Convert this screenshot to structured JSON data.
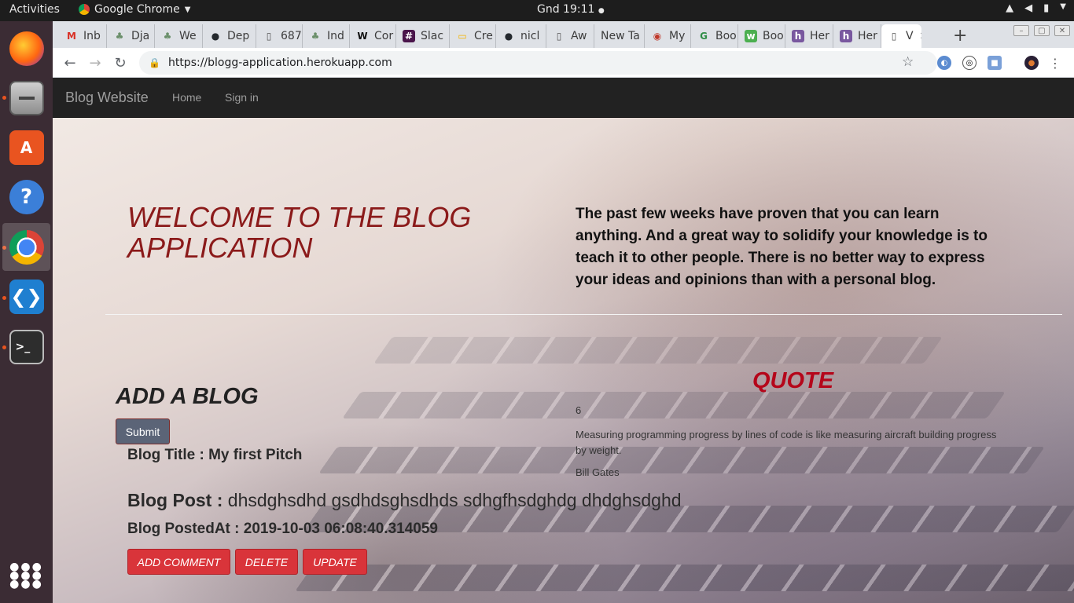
{
  "topbar": {
    "activities": "Activities",
    "app_name": "Google Chrome",
    "clock": "Gnd 19:11"
  },
  "dock": {
    "items": [
      "firefox-icon",
      "files-icon",
      "software-center-icon",
      "help-icon",
      "chrome-icon",
      "vscode-icon",
      "terminal-icon",
      "app-grid-icon"
    ]
  },
  "browser": {
    "tabs": [
      {
        "label": "Inb",
        "icon": "gmail-icon"
      },
      {
        "label": "Dja",
        "icon": "django-icon"
      },
      {
        "label": "We",
        "icon": "django-icon"
      },
      {
        "label": "Dep",
        "icon": "github-icon"
      },
      {
        "label": "687",
        "icon": "page-icon"
      },
      {
        "label": "Ind",
        "icon": "django-icon"
      },
      {
        "label": "Cor",
        "icon": "wikipedia-icon"
      },
      {
        "label": "Slac",
        "icon": "slack-icon"
      },
      {
        "label": "Cre",
        "icon": "slides-icon"
      },
      {
        "label": "nicl",
        "icon": "github-icon"
      },
      {
        "label": "Aw",
        "icon": "page-icon"
      },
      {
        "label": "New Ta",
        "icon": ""
      },
      {
        "label": "My",
        "icon": "mw-icon"
      },
      {
        "label": "Boo",
        "icon": "gfg-icon"
      },
      {
        "label": "Boo",
        "icon": "w3-icon"
      },
      {
        "label": "Her",
        "icon": "heroku-icon"
      },
      {
        "label": "Her",
        "icon": "heroku-icon"
      },
      {
        "label": "V",
        "icon": "page-icon"
      }
    ],
    "url": "https://blogg-application.herokuapp.com"
  },
  "site": {
    "brand": "Blog Website",
    "nav": [
      "Home",
      "Sign in"
    ],
    "welcome": "WELCOME TO THE BLOG APPLICATION",
    "intro": "The past few weeks have proven that you can learn anything. And a great way to solidify your knowledge is to teach it to other people. There is no better way to express your ideas and opinions than with a personal blog.",
    "add_heading": "ADD A BLOG",
    "submit": "Submit",
    "post": {
      "title": "Blog Title : My first Pitch",
      "body_label": "Blog Post :",
      "body": "dhsdghsdhd gsdhdsghsdhds sdhgfhsdghdg dhdghsdghd",
      "posted_at": "Blog PostedAt : 2019-10-03 06:08:40.314059"
    },
    "actions": {
      "add_comment": "ADD COMMENT",
      "delete": "DELETE",
      "update": "UPDATE"
    },
    "quote": {
      "heading": "QUOTE",
      "id": "6",
      "text": "Measuring programming progress by lines of code is like measuring aircraft building progress by weight.",
      "author": "Bill Gates"
    }
  }
}
